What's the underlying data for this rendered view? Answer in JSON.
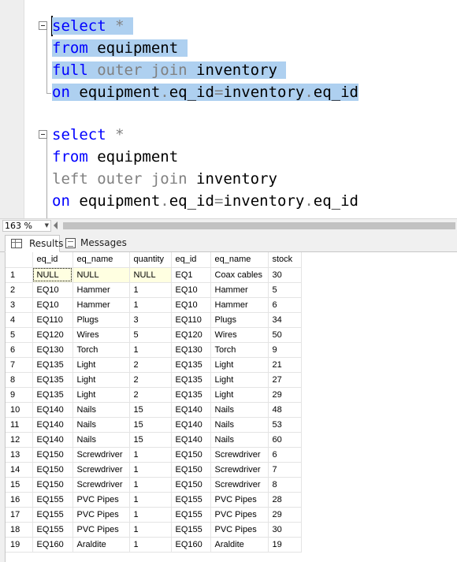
{
  "editor": {
    "query1": {
      "line1_kw": "select",
      "line1_rest": " *",
      "line2_kw": "from",
      "line2_rest": " equipment",
      "line3_kw": "full",
      "line3_op": " outer join",
      "line3_rest": " inventory",
      "line4_kw": "on",
      "line4_t1": " equipment",
      "line4_dot1": ".",
      "line4_t2": "eq_id",
      "line4_eq": "=",
      "line4_t3": "inventory",
      "line4_dot2": ".",
      "line4_t4": "eq_id"
    },
    "query2": {
      "line1_kw": "select",
      "line1_rest": " *",
      "line2_kw": "from",
      "line2_rest": " equipment",
      "line3_op": "left outer join",
      "line3_rest": " inventory",
      "line4_kw": "on",
      "line4_t1": " equipment",
      "line4_dot1": ".",
      "line4_t2": "eq_id",
      "line4_eq": "=",
      "line4_t3": "inventory",
      "line4_dot2": ".",
      "line4_t4": "eq_id"
    }
  },
  "zoom": {
    "level": "163 %"
  },
  "tabs": {
    "results_label": "Results",
    "messages_label": "Messages"
  },
  "grid": {
    "columns": [
      "eq_id",
      "eq_name",
      "quantity",
      "eq_id",
      "eq_name",
      "stock"
    ],
    "rows": [
      [
        "1",
        "NULL",
        "NULL",
        "NULL",
        "EQ1",
        "Coax cables",
        "30"
      ],
      [
        "2",
        "EQ10",
        "Hammer",
        "1",
        "EQ10",
        "Hammer",
        "5"
      ],
      [
        "3",
        "EQ10",
        "Hammer",
        "1",
        "EQ10",
        "Hammer",
        "6"
      ],
      [
        "4",
        "EQ110",
        "Plugs",
        "3",
        "EQ110",
        "Plugs",
        "34"
      ],
      [
        "5",
        "EQ120",
        "Wires",
        "5",
        "EQ120",
        "Wires",
        "50"
      ],
      [
        "6",
        "EQ130",
        "Torch",
        "1",
        "EQ130",
        "Torch",
        "9"
      ],
      [
        "7",
        "EQ135",
        "Light",
        "2",
        "EQ135",
        "Light",
        "21"
      ],
      [
        "8",
        "EQ135",
        "Light",
        "2",
        "EQ135",
        "Light",
        "27"
      ],
      [
        "9",
        "EQ135",
        "Light",
        "2",
        "EQ135",
        "Light",
        "29"
      ],
      [
        "10",
        "EQ140",
        "Nails",
        "15",
        "EQ140",
        "Nails",
        "48"
      ],
      [
        "11",
        "EQ140",
        "Nails",
        "15",
        "EQ140",
        "Nails",
        "53"
      ],
      [
        "12",
        "EQ140",
        "Nails",
        "15",
        "EQ140",
        "Nails",
        "60"
      ],
      [
        "13",
        "EQ150",
        "Screwdriver",
        "1",
        "EQ150",
        "Screwdriver",
        "6"
      ],
      [
        "14",
        "EQ150",
        "Screwdriver",
        "1",
        "EQ150",
        "Screwdriver",
        "7"
      ],
      [
        "15",
        "EQ150",
        "Screwdriver",
        "1",
        "EQ150",
        "Screwdriver",
        "8"
      ],
      [
        "16",
        "EQ155",
        "PVC Pipes",
        "1",
        "EQ155",
        "PVC Pipes",
        "28"
      ],
      [
        "17",
        "EQ155",
        "PVC Pipes",
        "1",
        "EQ155",
        "PVC Pipes",
        "29"
      ],
      [
        "18",
        "EQ155",
        "PVC Pipes",
        "1",
        "EQ155",
        "PVC Pipes",
        "30"
      ],
      [
        "19",
        "EQ160",
        "Araldite",
        "1",
        "EQ160",
        "Araldite",
        "19"
      ]
    ]
  }
}
